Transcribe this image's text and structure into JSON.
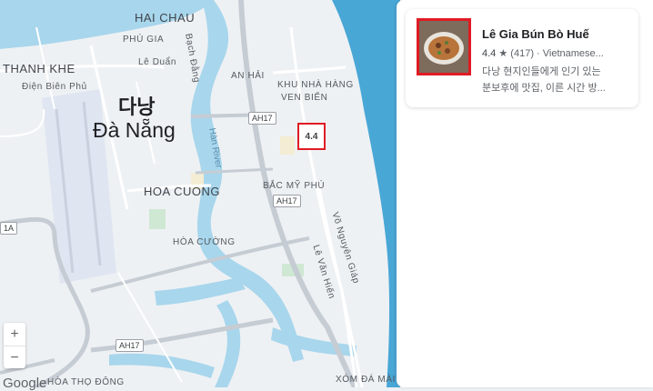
{
  "map": {
    "labels": {
      "hai_chau": "HAI CHAU",
      "phu_gia": "PHÚ GIA",
      "bach_dang": "Bạch Đằng",
      "thanh_khe": "THANH KHE",
      "le_duan": "Lê Duẩn",
      "dien_bien_phu": "Điện Biên Phủ",
      "an_hai": "AN HẢI",
      "khu_nha_hang_1": "KHU NHÀ HÀNG",
      "khu_nha_hang_2": "VEN BIỂN",
      "city_korean": "다낭",
      "city_vietnamese": "Đà Nẵng",
      "han_river": "Hàn River",
      "hoa_cuong": "HOA CUONG",
      "bac_my_phu": "BẮC MỸ PHÚ",
      "hoa_cuong_small": "HÒA CƯỜNG",
      "vo_nguyen_giap": "Võ Nguyên Giáp",
      "le_van_hien": "Lê Văn Hiến",
      "xom_da_mai": "XÓM ĐÁ MÀI",
      "hoa_tho_dong": "HÒA THỌ ĐÔNG",
      "road_1a": "1A",
      "ah17_1": "AH17",
      "ah17_2": "AH17",
      "ah17_3": "AH17"
    },
    "marker": {
      "rating": "4.4"
    },
    "zoom": {
      "plus": "+",
      "minus": "−"
    },
    "attribution": "Google"
  },
  "colors": {
    "water": "#a8d6ec",
    "sea": "#49a7d6",
    "land": "#eef1f4",
    "road": "#ffffff",
    "highway": "#c6ccd3",
    "airport": "#dfe5f1",
    "highlight": "#e01b24"
  },
  "result": {
    "name": "Lê Gia Bún Bò Huế",
    "rating": "4.4",
    "star_icon": "star",
    "review_count": "(417)",
    "separator": "·",
    "category": "Vietnamese...",
    "description_line1": "다낭 현지인들에게 인기 있는",
    "description_line2": "분보후에 맛집, 이른 시간 방..."
  }
}
